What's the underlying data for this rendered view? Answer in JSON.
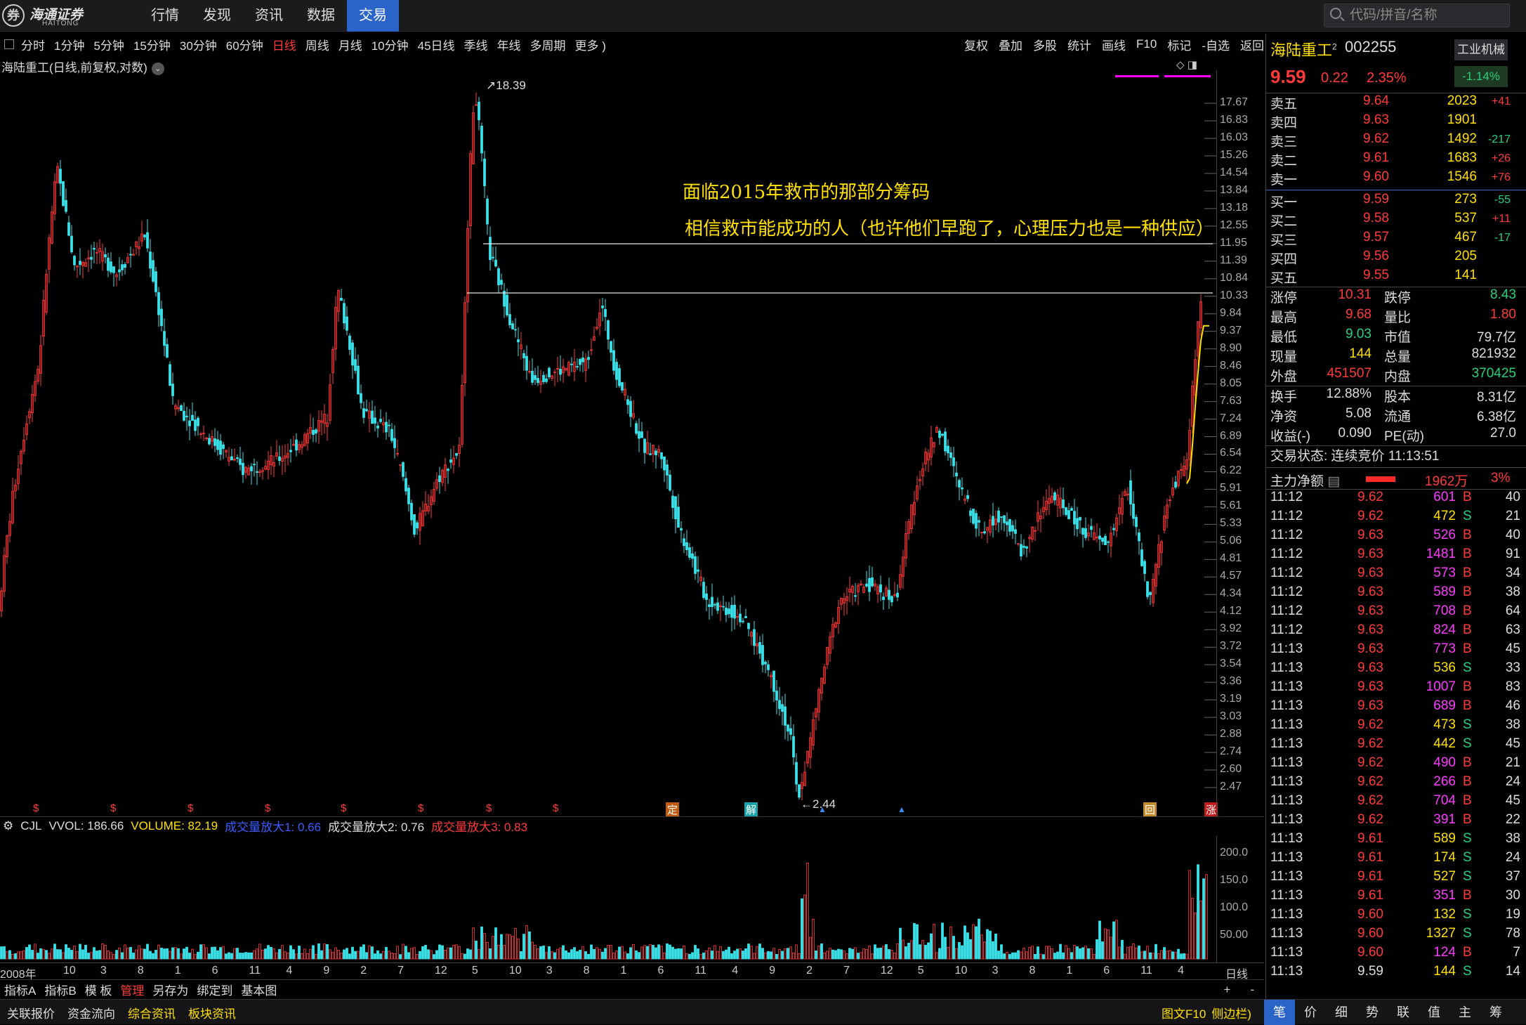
{
  "app": {
    "logo_cn": "海通证券",
    "logo_en": "HAITONG"
  },
  "nav": [
    "行情",
    "发现",
    "资讯",
    "数据",
    "交易"
  ],
  "nav_active": 4,
  "search": {
    "placeholder": "代码/拼音/名称"
  },
  "period_tabs": [
    "分时",
    "1分钟",
    "5分钟",
    "15分钟",
    "30分钟",
    "60分钟",
    "日线",
    "周线",
    "月线",
    "10分钟",
    "45日线",
    "季线",
    "年线",
    "多周期",
    "更多 )"
  ],
  "period_active": 6,
  "tools": [
    "复权",
    "叠加",
    "多股",
    "统计",
    "画线",
    "F10",
    "标记",
    "-自选",
    "返回"
  ],
  "chart_title": "海陆重工(日线,前复权,对数)",
  "annotations": [
    "面临2015年救市的那部分筹码",
    "相信救市能成功的人（也许他们早跑了，心理压力也是一种供应）"
  ],
  "high_label": "18.39",
  "low_label": "2.44",
  "events": [
    "$",
    "$",
    "$",
    "$",
    "$",
    "$",
    "$",
    "$",
    "定",
    "解",
    "回",
    "涨"
  ],
  "y_ticks": [
    "17.67",
    "16.83",
    "16.03",
    "15.26",
    "14.54",
    "13.84",
    "13.18",
    "12.55",
    "11.95",
    "11.39",
    "10.84",
    "10.33",
    "9.84",
    "9.37",
    "8.90",
    "8.46",
    "8.05",
    "7.63",
    "7.24",
    "6.89",
    "6.54",
    "6.22",
    "5.91",
    "5.61",
    "5.33",
    "5.06",
    "4.81",
    "4.57",
    "4.34",
    "4.12",
    "3.92",
    "3.72",
    "3.54",
    "3.36",
    "3.19",
    "3.03",
    "2.88",
    "2.74",
    "2.60",
    "2.47"
  ],
  "vol_header": {
    "name": "CJL",
    "vvol": "VVOL: 186.66",
    "volume": "VOLUME: 82.19",
    "f1": "成交量放大1: 0.66",
    "f2": "成交量放大2: 0.76",
    "f3": "成交量放大3: 0.83"
  },
  "vol_y_ticks": [
    "200.0",
    "150.0",
    "100.0",
    "50.00"
  ],
  "x_ticks": [
    "2008年",
    "10",
    "3",
    "8",
    "1",
    "6",
    "11",
    "4",
    "9",
    "2",
    "7",
    "12",
    "5",
    "10",
    "3",
    "8",
    "1",
    "6",
    "11",
    "4",
    "9",
    "2",
    "7",
    "12",
    "5",
    "10",
    "3",
    "8",
    "1",
    "6",
    "11",
    "4"
  ],
  "x_period": "日线",
  "bottom_bar1": [
    "指标A",
    "指标B",
    "模 板",
    "管理",
    "另存为",
    "绑定到",
    "基本图"
  ],
  "bottom_bar1_red": 3,
  "bottom_bar2": [
    "关联报价",
    "资金流向",
    "综合资讯",
    "板块资讯"
  ],
  "bottom_bar2_right": [
    "图文F10",
    "侧边栏)"
  ],
  "right_tabs": [
    "笔",
    "价",
    "细",
    "势",
    "联",
    "值",
    "主",
    "筹"
  ],
  "stock": {
    "name": "海陆重工",
    "sup": "2",
    "code": "002255",
    "industry": "工业机械",
    "industry_pct": "-1.14%",
    "price": "9.59",
    "change": "0.22",
    "pct": "2.35%"
  },
  "asks": [
    [
      "卖五",
      "9.64",
      "2023",
      "+41"
    ],
    [
      "卖四",
      "9.63",
      "1901",
      ""
    ],
    [
      "卖三",
      "9.62",
      "1492",
      "-217"
    ],
    [
      "卖二",
      "9.61",
      "1683",
      "+26"
    ],
    [
      "卖一",
      "9.60",
      "1546",
      "+76"
    ]
  ],
  "bids": [
    [
      "买一",
      "9.59",
      "273",
      "-55"
    ],
    [
      "买二",
      "9.58",
      "537",
      "+11"
    ],
    [
      "买三",
      "9.57",
      "467",
      "-17"
    ],
    [
      "买四",
      "9.56",
      "205",
      ""
    ],
    [
      "买五",
      "9.55",
      "141",
      ""
    ]
  ],
  "stats1": [
    [
      "涨停",
      "10.31",
      "跌停",
      "8.43"
    ],
    [
      "最高",
      "9.68",
      "量比",
      "1.80"
    ],
    [
      "最低",
      "9.03",
      "市值",
      "79.7亿"
    ],
    [
      "现量",
      "144",
      "总量",
      "821932"
    ],
    [
      "外盘",
      "451507",
      "内盘",
      "370425"
    ]
  ],
  "stats2": [
    [
      "换手",
      "12.88%",
      "股本",
      "8.31亿"
    ],
    [
      "净资",
      "5.08",
      "流通",
      "6.38亿"
    ],
    [
      "收益(-)",
      "0.090",
      "PE(动)",
      "27.0"
    ]
  ],
  "trade_status": "交易状态: 连续竞价 11:13:51",
  "flow": {
    "label": "主力净额",
    "value": "1962万",
    "pct": "3%"
  },
  "ticks": [
    [
      "11:12",
      "9.62",
      "601",
      "B",
      "40"
    ],
    [
      "11:12",
      "9.62",
      "472",
      "S",
      "21"
    ],
    [
      "11:12",
      "9.63",
      "526",
      "B",
      "40"
    ],
    [
      "11:12",
      "9.63",
      "1481",
      "B",
      "91"
    ],
    [
      "11:12",
      "9.63",
      "573",
      "B",
      "34"
    ],
    [
      "11:12",
      "9.63",
      "589",
      "B",
      "38"
    ],
    [
      "11:12",
      "9.63",
      "708",
      "B",
      "64"
    ],
    [
      "11:12",
      "9.63",
      "824",
      "B",
      "63"
    ],
    [
      "11:13",
      "9.63",
      "773",
      "B",
      "45"
    ],
    [
      "11:13",
      "9.63",
      "536",
      "S",
      "33"
    ],
    [
      "11:13",
      "9.63",
      "1007",
      "B",
      "83"
    ],
    [
      "11:13",
      "9.63",
      "689",
      "B",
      "46"
    ],
    [
      "11:13",
      "9.62",
      "473",
      "S",
      "38"
    ],
    [
      "11:13",
      "9.62",
      "442",
      "S",
      "45"
    ],
    [
      "11:13",
      "9.62",
      "490",
      "B",
      "21"
    ],
    [
      "11:13",
      "9.62",
      "266",
      "B",
      "24"
    ],
    [
      "11:13",
      "9.62",
      "704",
      "B",
      "45"
    ],
    [
      "11:13",
      "9.62",
      "391",
      "B",
      "22"
    ],
    [
      "11:13",
      "9.61",
      "589",
      "S",
      "38"
    ],
    [
      "11:13",
      "9.61",
      "174",
      "S",
      "24"
    ],
    [
      "11:13",
      "9.61",
      "527",
      "S",
      "37"
    ],
    [
      "11:13",
      "9.61",
      "351",
      "B",
      "30"
    ],
    [
      "11:13",
      "9.60",
      "132",
      "S",
      "19"
    ],
    [
      "11:13",
      "9.60",
      "1327",
      "S",
      "78"
    ],
    [
      "11:13",
      "9.60",
      "124",
      "B",
      "7"
    ],
    [
      "11:13",
      "9.59",
      "144",
      "S",
      "14"
    ]
  ],
  "colors": {
    "up": "#ff3a3a",
    "down": "#3ae0e8",
    "accent": "#2a64c8",
    "annotation": "#ffe000"
  }
}
